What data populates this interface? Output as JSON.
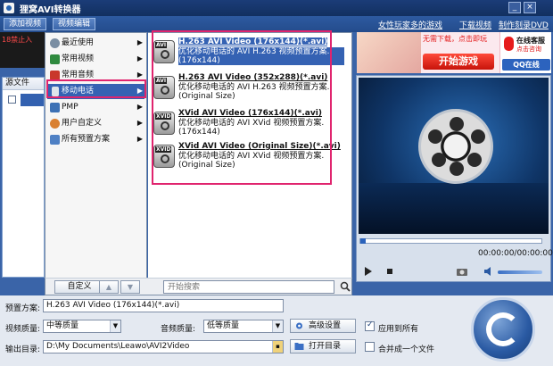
{
  "window": {
    "title": "狸窝AVI转换器"
  },
  "menubar": {
    "add_video": "添加视频",
    "edit_video": "视频编辑",
    "links": [
      "女性玩家多的游戏",
      "下载视频",
      "制作刻录DVD"
    ]
  },
  "left": {
    "banner_text": "18禁止入",
    "file_header": "源文件"
  },
  "category_menu": {
    "items": [
      {
        "label": "最近使用",
        "icon": "clock-icon",
        "color": "#6a7a8c"
      },
      {
        "label": "常用视频",
        "icon": "video-icon",
        "color": "#2a7a3a"
      },
      {
        "label": "常用音频",
        "icon": "audio-icon",
        "color": "#c0392b"
      },
      {
        "label": "移动电话",
        "icon": "phone-icon",
        "color": "#555555",
        "selected": true
      },
      {
        "label": "PMP",
        "icon": "pmp-icon",
        "color": "#3a6fb0"
      },
      {
        "label": "用户自定义",
        "icon": "user-icon",
        "color": "#d4752a"
      },
      {
        "label": "所有预置方案",
        "icon": "folder-icon",
        "color": "#4a7bc0"
      }
    ]
  },
  "presets": [
    {
      "device_label": "AVI",
      "name": "H.263 AVI Video (176x144)(*.avi)",
      "desc": "优化移动电话的 AVI H.263 视频预置方案.(176x144)",
      "selected": true
    },
    {
      "device_label": "AVI",
      "name": "H.263 AVI Video (352x288)(*.avi)",
      "desc": "优化移动电话的 AVI H.263 视频预置方案.(Original Size)"
    },
    {
      "device_label": "XVID",
      "name": "XVid AVI Video (176x144)(*.avi)",
      "desc": "优化移动电话的 AVI XVid 视频预置方案.(176x144)"
    },
    {
      "device_label": "XVID",
      "name": "XVid AVI Video (Original Size)(*.avi)",
      "desc": "优化移动电话的 AVI XVid 视频预置方案.(Original Size)"
    }
  ],
  "popup_bottom": {
    "custom_button": "自定义",
    "search_placeholder": "开始搜索"
  },
  "ad": {
    "top_text": "无需下载，点击即玩",
    "start_button": "开始游戏",
    "service_title": "在线客服",
    "service_sub": "点击咨询",
    "qq_button": "QQ在线"
  },
  "player": {
    "time": "00:00:00/00:00:00",
    "seek_progress": 0.0
  },
  "settings": {
    "preset_label": "预置方案:",
    "preset_value": "H.263 AVI Video (176x144)(*.avi)",
    "video_quality_label": "视频质量:",
    "video_quality_value": "中等质量",
    "audio_quality_label": "音频质量:",
    "audio_quality_value": "低等质量",
    "advanced_button": "高级设置",
    "apply_all_label": "应用到所有",
    "apply_all_checked": true,
    "output_label": "输出目录:",
    "output_value": "D:\\My Documents\\Leawo\\AVI2Video",
    "open_folder_button": "打开目录",
    "merge_label": "合并成一个文件",
    "merge_checked": false
  }
}
